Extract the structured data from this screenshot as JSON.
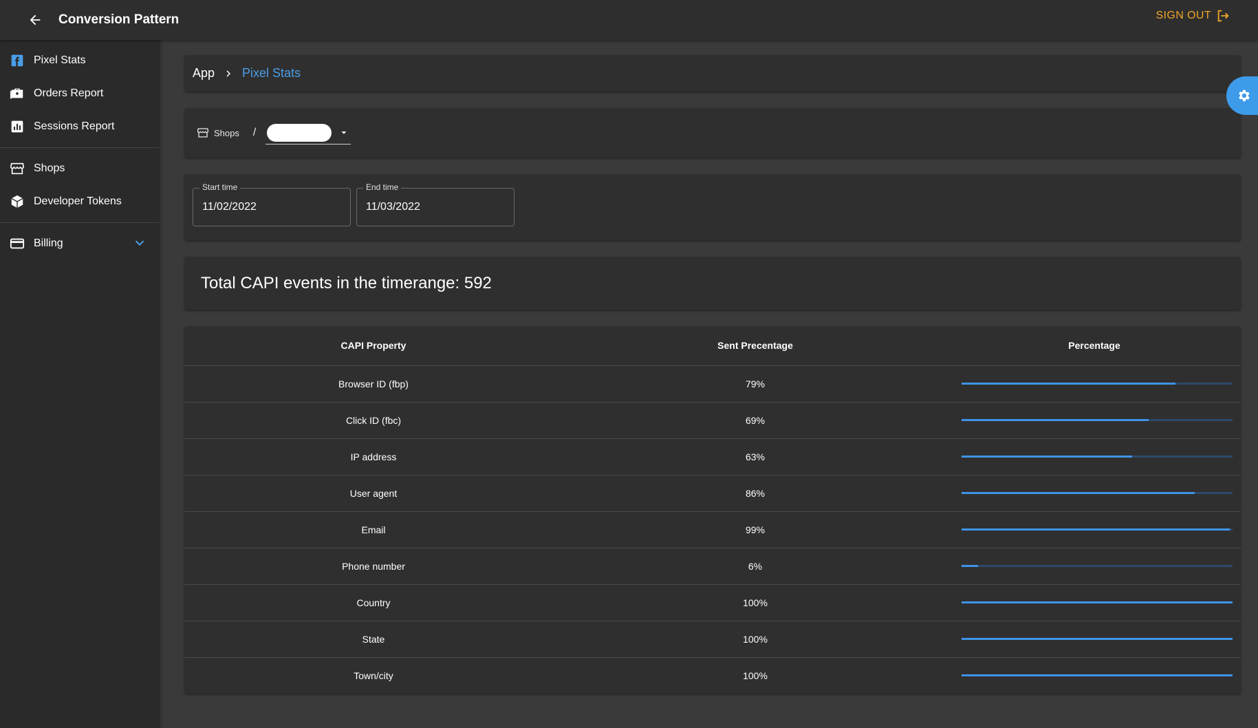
{
  "appbar": {
    "title": "Conversion Pattern",
    "signout_label": "SIGN OUT"
  },
  "sidebar": {
    "groups": [
      {
        "items": [
          {
            "label": "Pixel Stats",
            "icon": "facebook-icon"
          },
          {
            "label": "Orders Report",
            "icon": "briefcase-icon"
          },
          {
            "label": "Sessions Report",
            "icon": "bar-chart-icon"
          }
        ]
      },
      {
        "items": [
          {
            "label": "Shops",
            "icon": "store-icon"
          },
          {
            "label": "Developer Tokens",
            "icon": "cube-icon"
          }
        ]
      },
      {
        "items": [
          {
            "label": "Billing",
            "icon": "credit-card-icon"
          }
        ]
      }
    ]
  },
  "breadcrumb": {
    "root": "App",
    "current": "Pixel Stats"
  },
  "shops": {
    "label": "Shops",
    "separator": "/"
  },
  "dates": {
    "start": {
      "label": "Start time",
      "value": "11/02/2022"
    },
    "end": {
      "label": "End time",
      "value": "11/03/2022"
    }
  },
  "total": {
    "text": "Total CAPI events in the timerange: 592"
  },
  "table": {
    "headers": [
      "CAPI Property",
      "Sent Precentage",
      "Percentage"
    ],
    "rows": [
      {
        "property": "Browser ID (fbp)",
        "sent": "79%",
        "pct": 79
      },
      {
        "property": "Click ID (fbc)",
        "sent": "69%",
        "pct": 69
      },
      {
        "property": "IP address",
        "sent": "63%",
        "pct": 63
      },
      {
        "property": "User agent",
        "sent": "86%",
        "pct": 86
      },
      {
        "property": "Email",
        "sent": "99%",
        "pct": 99
      },
      {
        "property": "Phone number",
        "sent": "6%",
        "pct": 6
      },
      {
        "property": "Country",
        "sent": "100%",
        "pct": 100
      },
      {
        "property": "State",
        "sent": "100%",
        "pct": 100
      },
      {
        "property": "Town/city",
        "sent": "100%",
        "pct": 100
      }
    ]
  },
  "colors": {
    "accent": "#4a9ee8",
    "signout": "#f0a62c",
    "bar_fill": "#3f94e8",
    "bar_track": "#2d4a6b"
  }
}
